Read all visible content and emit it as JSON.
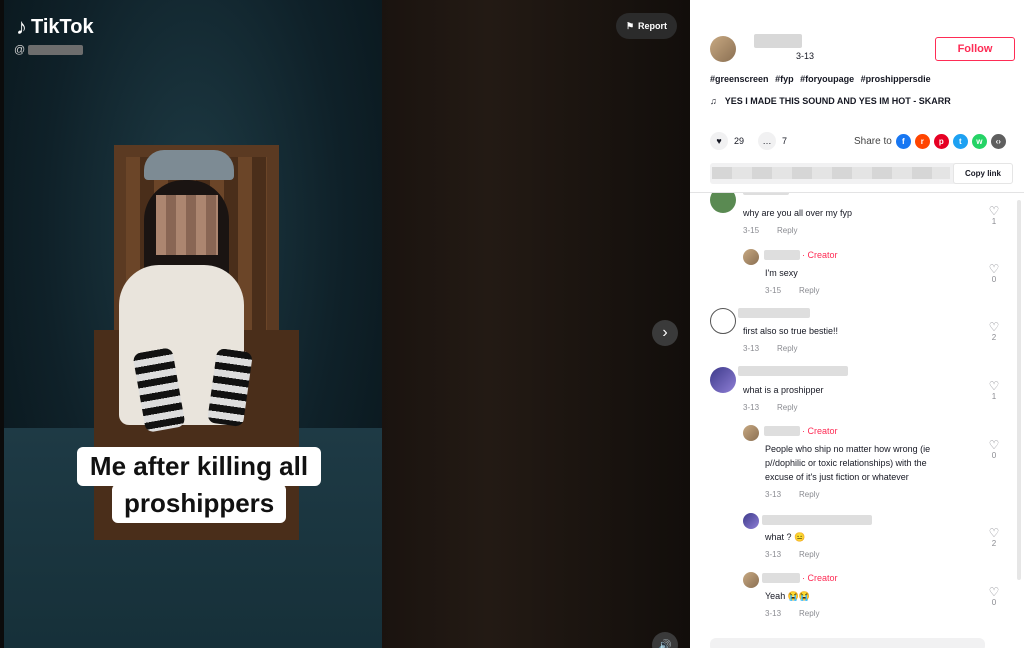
{
  "video": {
    "brand": "TikTok",
    "handle_prefix": "@",
    "report_label": "Report",
    "caption_line1": "Me after killing all",
    "caption_line2": "proshippers"
  },
  "post": {
    "date": "3-13",
    "follow_label": "Follow",
    "hashtags": [
      "#greenscreen",
      "#fyp",
      "#foryoupage",
      "#proshippersdie"
    ],
    "music": "YES I MADE THIS SOUND AND YES IM HOT - SKARR",
    "likes": "29",
    "comments_count": "7",
    "share_to_label": "Share to",
    "copy_link_label": "Copy link"
  },
  "comments": [
    {
      "text": "why are you all over my fyp",
      "date": "3-15",
      "reply": "Reply",
      "likes": "1"
    },
    {
      "creator": "· Creator",
      "text": "I'm sexy",
      "date": "3-15",
      "reply": "Reply",
      "likes": "0"
    },
    {
      "text": "first also so true bestie!!",
      "date": "3-13",
      "reply": "Reply",
      "likes": "2"
    },
    {
      "text": "what is a proshipper",
      "date": "3-13",
      "reply": "Reply",
      "likes": "1"
    },
    {
      "creator": "· Creator",
      "text_lines": [
        "People who ship no matter how wrong (ie",
        "p//dophilic or toxic relationships) with the",
        "excuse of it's just fiction or whatever"
      ],
      "date": "3-13",
      "reply": "Reply",
      "likes": "0"
    },
    {
      "text": "what ? 😑",
      "date": "3-13",
      "reply": "Reply",
      "likes": "2"
    },
    {
      "creator": "· Creator",
      "text": "Yeah 😭😭",
      "date": "3-13",
      "reply": "Reply",
      "likes": "0"
    }
  ]
}
